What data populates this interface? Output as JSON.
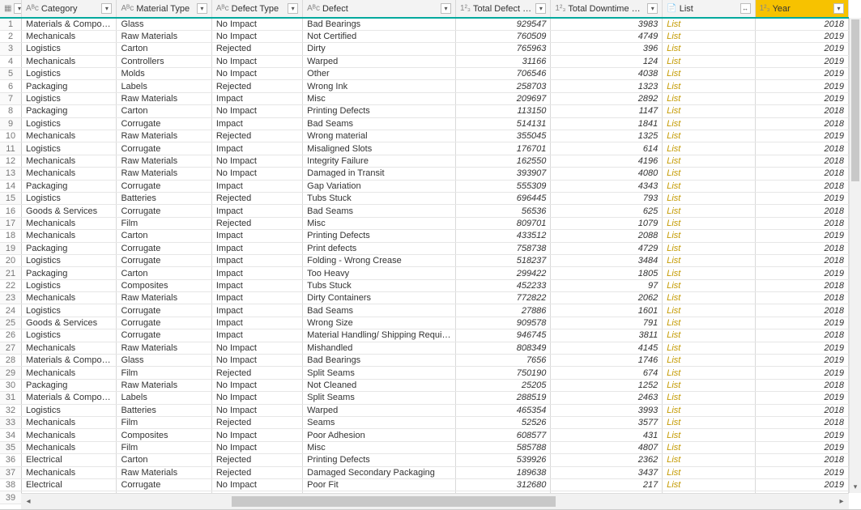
{
  "columns": {
    "category": {
      "label": "Category",
      "type": "text"
    },
    "material": {
      "label": "Material Type",
      "type": "text"
    },
    "defectType": {
      "label": "Defect Type",
      "type": "text"
    },
    "defect": {
      "label": "Defect",
      "type": "text"
    },
    "qty": {
      "label": "Total Defect Qty",
      "type": "number"
    },
    "downtime": {
      "label": "Total Downtime Minutes",
      "type": "number"
    },
    "list": {
      "label": "List",
      "type": "list"
    },
    "year": {
      "label": "Year",
      "type": "number"
    }
  },
  "list_value": "List",
  "rows": [
    {
      "n": 1,
      "category": "Materials & Components",
      "material": "Glass",
      "defectType": "No Impact",
      "defect": "Bad Bearings",
      "qty": 929547,
      "downtime": 3983,
      "year": 2018
    },
    {
      "n": 2,
      "category": "Mechanicals",
      "material": "Raw Materials",
      "defectType": "No Impact",
      "defect": "Not Certified",
      "qty": 760509,
      "downtime": 4749,
      "year": 2019
    },
    {
      "n": 3,
      "category": "Logistics",
      "material": "Carton",
      "defectType": "Rejected",
      "defect": "Dirty",
      "qty": 765963,
      "downtime": 396,
      "year": 2019
    },
    {
      "n": 4,
      "category": "Mechanicals",
      "material": "Controllers",
      "defectType": "No Impact",
      "defect": "Warped",
      "qty": 31166,
      "downtime": 124,
      "year": 2019
    },
    {
      "n": 5,
      "category": "Logistics",
      "material": "Molds",
      "defectType": "No Impact",
      "defect": "Other",
      "qty": 706546,
      "downtime": 4038,
      "year": 2019
    },
    {
      "n": 6,
      "category": "Packaging",
      "material": "Labels",
      "defectType": "Rejected",
      "defect": "Wrong Ink",
      "qty": 258703,
      "downtime": 1323,
      "year": 2019
    },
    {
      "n": 7,
      "category": "Logistics",
      "material": "Raw Materials",
      "defectType": "Impact",
      "defect": "Misc",
      "qty": 209697,
      "downtime": 2892,
      "year": 2019
    },
    {
      "n": 8,
      "category": "Packaging",
      "material": "Carton",
      "defectType": "No Impact",
      "defect": "Printing Defects",
      "qty": 113150,
      "downtime": 1147,
      "year": 2018
    },
    {
      "n": 9,
      "category": "Logistics",
      "material": "Corrugate",
      "defectType": "Impact",
      "defect": "Bad Seams",
      "qty": 514131,
      "downtime": 1841,
      "year": 2018
    },
    {
      "n": 10,
      "category": "Mechanicals",
      "material": "Raw Materials",
      "defectType": "Rejected",
      "defect": "Wrong material",
      "qty": 355045,
      "downtime": 1325,
      "year": 2019
    },
    {
      "n": 11,
      "category": "Logistics",
      "material": "Corrugate",
      "defectType": "Impact",
      "defect": "Misaligned Slots",
      "qty": 176701,
      "downtime": 614,
      "year": 2018
    },
    {
      "n": 12,
      "category": "Mechanicals",
      "material": "Raw Materials",
      "defectType": "No Impact",
      "defect": "Integrity Failure",
      "qty": 162550,
      "downtime": 4196,
      "year": 2018
    },
    {
      "n": 13,
      "category": "Mechanicals",
      "material": "Raw Materials",
      "defectType": "No Impact",
      "defect": "Damaged in Transit",
      "qty": 393907,
      "downtime": 4080,
      "year": 2018
    },
    {
      "n": 14,
      "category": "Packaging",
      "material": "Corrugate",
      "defectType": "Impact",
      "defect": "Gap Variation",
      "qty": 555309,
      "downtime": 4343,
      "year": 2018
    },
    {
      "n": 15,
      "category": "Logistics",
      "material": "Batteries",
      "defectType": "Rejected",
      "defect": "Tubs Stuck",
      "qty": 696445,
      "downtime": 793,
      "year": 2019
    },
    {
      "n": 16,
      "category": "Goods & Services",
      "material": "Corrugate",
      "defectType": "Impact",
      "defect": "Bad Seams",
      "qty": 56536,
      "downtime": 625,
      "year": 2018
    },
    {
      "n": 17,
      "category": "Mechanicals",
      "material": "Film",
      "defectType": "Rejected",
      "defect": "Misc",
      "qty": 809701,
      "downtime": 1079,
      "year": 2018
    },
    {
      "n": 18,
      "category": "Mechanicals",
      "material": "Carton",
      "defectType": "Impact",
      "defect": "Printing Defects",
      "qty": 433512,
      "downtime": 2088,
      "year": 2019
    },
    {
      "n": 19,
      "category": "Packaging",
      "material": "Corrugate",
      "defectType": "Impact",
      "defect": "Print defects",
      "qty": 758738,
      "downtime": 4729,
      "year": 2018
    },
    {
      "n": 20,
      "category": "Logistics",
      "material": "Corrugate",
      "defectType": "Impact",
      "defect": "Folding - Wrong Crease",
      "qty": 518237,
      "downtime": 3484,
      "year": 2018
    },
    {
      "n": 21,
      "category": "Packaging",
      "material": "Carton",
      "defectType": "Impact",
      "defect": "Too Heavy",
      "qty": 299422,
      "downtime": 1805,
      "year": 2019
    },
    {
      "n": 22,
      "category": "Logistics",
      "material": "Composites",
      "defectType": "Impact",
      "defect": "Tubs Stuck",
      "qty": 452233,
      "downtime": 97,
      "year": 2018
    },
    {
      "n": 23,
      "category": "Mechanicals",
      "material": "Raw Materials",
      "defectType": "Impact",
      "defect": "Dirty Containers",
      "qty": 772822,
      "downtime": 2062,
      "year": 2018
    },
    {
      "n": 24,
      "category": "Logistics",
      "material": "Corrugate",
      "defectType": "Impact",
      "defect": "Bad Seams",
      "qty": 27886,
      "downtime": 1601,
      "year": 2018
    },
    {
      "n": 25,
      "category": "Goods & Services",
      "material": "Corrugate",
      "defectType": "Impact",
      "defect": "Wrong  Size",
      "qty": 909578,
      "downtime": 791,
      "year": 2019
    },
    {
      "n": 26,
      "category": "Logistics",
      "material": "Corrugate",
      "defectType": "Impact",
      "defect": "Material Handling/ Shipping Requirements Error",
      "qty": 946745,
      "downtime": 3811,
      "year": 2018
    },
    {
      "n": 27,
      "category": "Mechanicals",
      "material": "Raw Materials",
      "defectType": "No Impact",
      "defect": "Mishandled",
      "qty": 808349,
      "downtime": 4145,
      "year": 2019
    },
    {
      "n": 28,
      "category": "Materials & Components",
      "material": "Glass",
      "defectType": "No Impact",
      "defect": "Bad Bearings",
      "qty": 7656,
      "downtime": 1746,
      "year": 2019
    },
    {
      "n": 29,
      "category": "Mechanicals",
      "material": "Film",
      "defectType": "Rejected",
      "defect": "Split Seams",
      "qty": 750190,
      "downtime": 674,
      "year": 2019
    },
    {
      "n": 30,
      "category": "Packaging",
      "material": "Raw Materials",
      "defectType": "No Impact",
      "defect": "Not Cleaned",
      "qty": 25205,
      "downtime": 1252,
      "year": 2018
    },
    {
      "n": 31,
      "category": "Materials & Components",
      "material": "Labels",
      "defectType": "No Impact",
      "defect": "Split Seams",
      "qty": 288519,
      "downtime": 2463,
      "year": 2019
    },
    {
      "n": 32,
      "category": "Logistics",
      "material": "Batteries",
      "defectType": "No Impact",
      "defect": "Warped",
      "qty": 465354,
      "downtime": 3993,
      "year": 2018
    },
    {
      "n": 33,
      "category": "Mechanicals",
      "material": "Film",
      "defectType": "Rejected",
      "defect": "Seams",
      "qty": 52526,
      "downtime": 3577,
      "year": 2018
    },
    {
      "n": 34,
      "category": "Mechanicals",
      "material": "Composites",
      "defectType": "No Impact",
      "defect": "Poor  Adhesion",
      "qty": 608577,
      "downtime": 431,
      "year": 2019
    },
    {
      "n": 35,
      "category": "Mechanicals",
      "material": "Film",
      "defectType": "No Impact",
      "defect": "Misc",
      "qty": 585788,
      "downtime": 4807,
      "year": 2019
    },
    {
      "n": 36,
      "category": "Electrical",
      "material": "Carton",
      "defectType": "Rejected",
      "defect": "Printing Defects",
      "qty": 539926,
      "downtime": 2362,
      "year": 2018
    },
    {
      "n": 37,
      "category": "Mechanicals",
      "material": "Raw Materials",
      "defectType": "Rejected",
      "defect": "Damaged Secondary Packaging",
      "qty": 189638,
      "downtime": 3437,
      "year": 2019
    },
    {
      "n": 38,
      "category": "Electrical",
      "material": "Corrugate",
      "defectType": "No Impact",
      "defect": "Poor Fit",
      "qty": 312680,
      "downtime": 217,
      "year": 2019
    }
  ],
  "blank_row": 39
}
